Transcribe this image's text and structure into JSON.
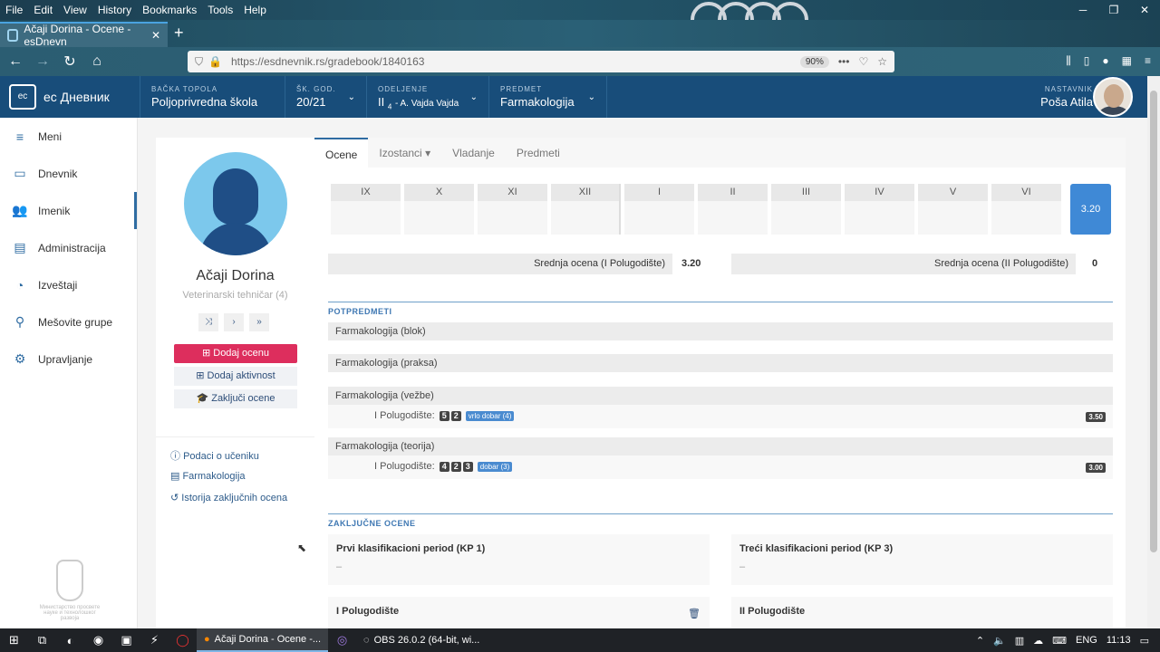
{
  "browser": {
    "menu": [
      "File",
      "Edit",
      "View",
      "History",
      "Bookmarks",
      "Tools",
      "Help"
    ],
    "tab_title": "Ačaji Dorina - Ocene - esDnevn",
    "url": "https://esdnevnik.rs/gradebook/1840163",
    "zoom": "90%"
  },
  "header": {
    "logo": "ес Дневник",
    "logo_badge": "ec",
    "school_label": "BAČKA TOPOLA",
    "school": "Poljoprivredna škola",
    "year_label": "ŠK. GOD.",
    "year": "20/21",
    "class_label": "ODELJENJE",
    "class_main": "II",
    "class_sub": "4",
    "class_teacher": "- A. Vajda Vajda",
    "subject_label": "PREDMET",
    "subject": "Farmakologija",
    "teacher_label": "NASTAVNIK",
    "teacher": "Poša Atila"
  },
  "sidebar": {
    "items": [
      {
        "label": "Meni",
        "icon": "≡"
      },
      {
        "label": "Dnevnik",
        "icon": "▭"
      },
      {
        "label": "Imenik",
        "icon": "👥"
      },
      {
        "label": "Administracija",
        "icon": "▤"
      },
      {
        "label": "Izveštaji",
        "icon": "◔"
      },
      {
        "label": "Mešovite grupe",
        "icon": "⚲"
      },
      {
        "label": "Upravljanje",
        "icon": "⚙"
      }
    ],
    "crest_caption": "Министарство просвете науке и технолошког развоја"
  },
  "student": {
    "name": "Ačaji Dorina",
    "program": "Veterinarski tehničar (4)",
    "add_grade": "Dodaj ocenu",
    "add_activity": "Dodaj aktivnost",
    "finalize": "Zaključi ocene",
    "links": [
      "Podaci o učeniku",
      "Farmakologija",
      "Istorija zaključnih ocena"
    ]
  },
  "tabs": [
    "Ocene",
    "Izostanci",
    "Vladanje",
    "Predmeti"
  ],
  "months": [
    "IX",
    "X",
    "XI",
    "XII",
    "I",
    "II",
    "III",
    "IV",
    "V",
    "VI"
  ],
  "final_value": "3.20",
  "averages": {
    "first_label": "Srednja ocena (I Polugodište)",
    "first_value": "3.20",
    "second_label": "Srednja ocena (II Polugodište)",
    "second_value": "0"
  },
  "subjects": {
    "header": "POTPREDMETI",
    "blok": "Farmakologija (blok)",
    "praksa": "Farmakologija (praksa)",
    "vezbe": "Farmakologija (vežbe)",
    "vezbe_period": "I Polugodište:",
    "vezbe_grades": [
      "5",
      "2"
    ],
    "vezbe_tag": "vrlo dobar (4)",
    "vezbe_avg": "3.50",
    "teorija": "Farmakologija (teorija)",
    "teorija_period": "I Polugodište:",
    "teorija_grades": [
      "4",
      "2",
      "3"
    ],
    "teorija_tag": "dobar (3)",
    "teorija_avg": "3.00"
  },
  "final_grades": {
    "header": "ZAKLJUČNE OCENE",
    "kp1_title": "Prvi klasifikacioni period (KP 1)",
    "kp1_value": "–",
    "kp3_title": "Treći klasifikacioni period (KP 3)",
    "kp3_value": "–",
    "sem1_title": "I Polugodište",
    "sem2_title": "II Polugodište"
  },
  "taskbar": {
    "firefox": "Ačaji Dorina - Ocene -...",
    "obs": "OBS 26.0.2 (64-bit, wi...",
    "lang": "ENG",
    "time": "11:13"
  }
}
